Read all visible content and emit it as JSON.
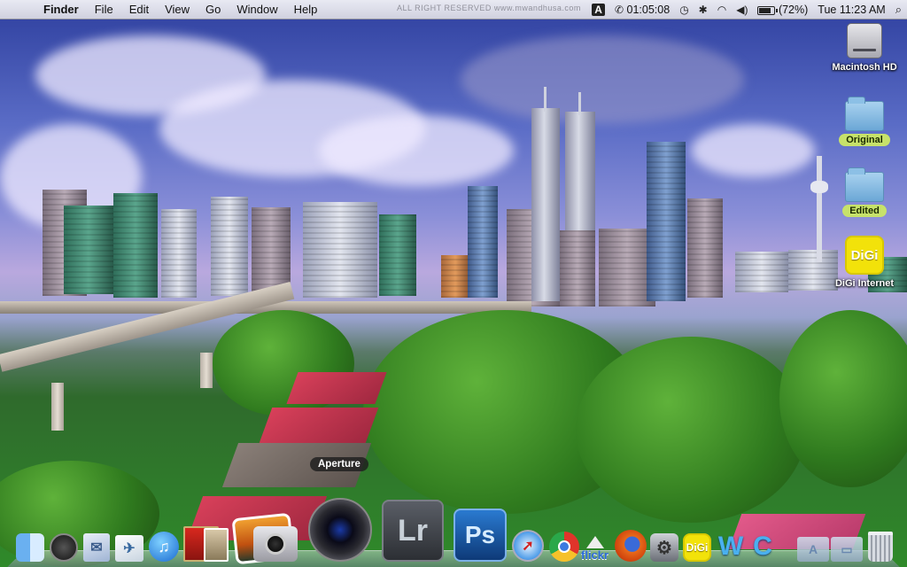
{
  "menubar": {
    "apple_icon": "apple-icon",
    "app_name": "Finder",
    "menus": [
      "File",
      "Edit",
      "View",
      "Go",
      "Window",
      "Help"
    ],
    "watermark": "ALL RIGHT RESERVED  www.mwandhusa.com",
    "status": {
      "input_icon": "A",
      "timer": "01:05:08",
      "battery_percent": "(72%)",
      "clock": "Tue 11:23 AM"
    }
  },
  "desktop": {
    "icons": [
      {
        "label": "Macintosh HD",
        "type": "hdd-icon"
      },
      {
        "label": "Original",
        "type": "folder-icon"
      },
      {
        "label": "Edited",
        "type": "folder-icon"
      },
      {
        "label": "DiGi Internet",
        "type": "digi-icon",
        "badge": "DiGi"
      }
    ]
  },
  "dock": {
    "tooltip": "Aperture",
    "items": [
      {
        "name": "finder"
      },
      {
        "name": "dashboard"
      },
      {
        "name": "mail"
      },
      {
        "name": "iphoto"
      },
      {
        "name": "itunes"
      },
      {
        "name": "front-row"
      },
      {
        "name": "photo-booth"
      },
      {
        "name": "iphoto-library"
      },
      {
        "name": "image-capture"
      },
      {
        "name": "aperture"
      },
      {
        "name": "lightroom",
        "text": "Lr"
      },
      {
        "name": "photoshop",
        "text": "Ps"
      },
      {
        "name": "safari"
      },
      {
        "name": "chrome"
      },
      {
        "name": "flickr",
        "text": "flickr"
      },
      {
        "name": "firefox"
      },
      {
        "name": "system-preferences"
      },
      {
        "name": "digi",
        "text": "DiGi"
      },
      {
        "name": "word",
        "text": "W"
      },
      {
        "name": "c-app",
        "text": "C"
      },
      {
        "name": "applications-folder",
        "text": "A"
      },
      {
        "name": "documents-folder"
      },
      {
        "name": "trash"
      }
    ]
  },
  "colors": {
    "menubar_bg": "#ececf0",
    "folder_tag": "#c7e26a",
    "digi_yellow": "#f2e20a",
    "photoshop_blue": "#1b5fa8",
    "lightroom_gray": "#3d4148"
  }
}
